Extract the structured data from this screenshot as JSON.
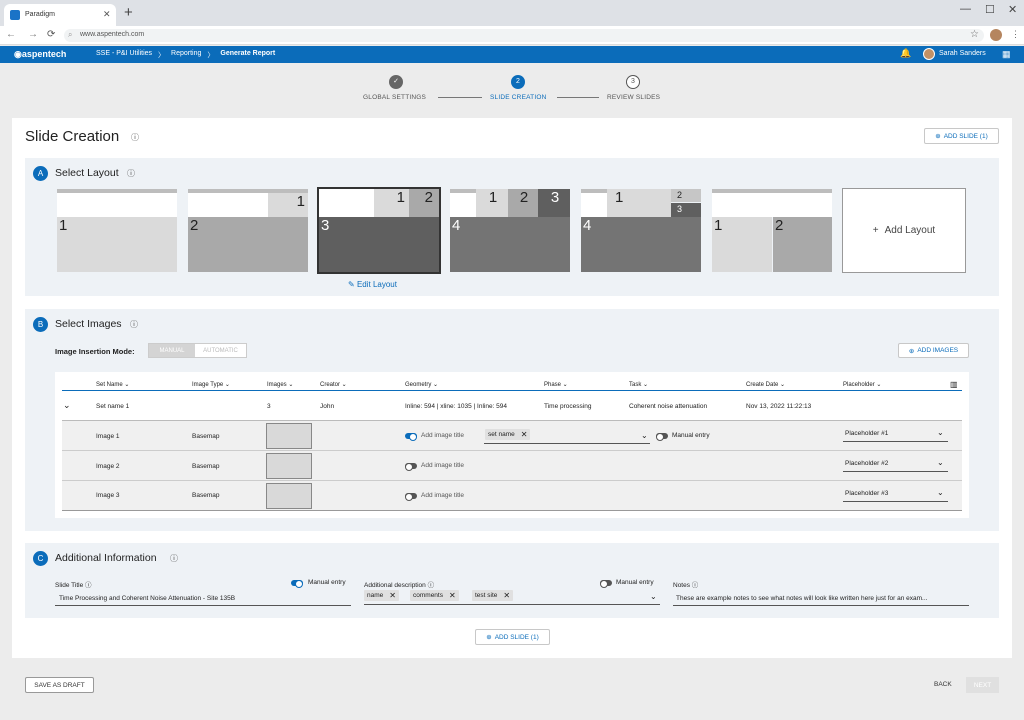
{
  "browser": {
    "tab_title": "Paradigm",
    "url": "www.aspentech.com"
  },
  "header": {
    "logo": "aspentech",
    "breadcrumbs": [
      "SSE - P&I Utilities",
      "Reporting",
      "Generate Report"
    ],
    "user": "Sarah Sanders"
  },
  "stepper": [
    {
      "num": "✓",
      "label": "GLOBAL SETTINGS"
    },
    {
      "num": "2",
      "label": "SLIDE CREATION"
    },
    {
      "num": "3",
      "label": "REVIEW SLIDES"
    }
  ],
  "page": {
    "title": "Slide Creation",
    "add_slide_top": "ADD SLIDE (1)",
    "add_slide_bottom": "ADD SLIDE (1)"
  },
  "layout_section": {
    "badge": "A",
    "title": "Select Layout",
    "edit_label": "Edit Layout",
    "add_layout": "Add Layout",
    "cards": [
      [
        "1"
      ],
      [
        "2",
        "1"
      ],
      [
        "3",
        "1",
        "2"
      ],
      [
        "4",
        "1",
        "2",
        "3"
      ],
      [
        "4",
        "1",
        "2",
        "3"
      ],
      [
        "1",
        "2"
      ]
    ]
  },
  "images_section": {
    "badge": "B",
    "title": "Select Images",
    "mode_label": "Image Insertion Mode:",
    "mode_options": [
      "MANUAL",
      "AUTOMATIC"
    ],
    "add_images": "ADD IMAGES",
    "columns": [
      "Set Name",
      "Image Type",
      "Images",
      "Creator",
      "Geometry",
      "Phase",
      "Task",
      "Create Date",
      "Placeholder"
    ],
    "set_row": {
      "name": "Set name 1",
      "images": "3",
      "creator": "John",
      "geometry": "Inline: 594 | xline: 1035 | Inline: 594",
      "phase": "Time processing",
      "task": "Coherent noise attenuation",
      "date": "Nov 13, 2022 11:22:13"
    },
    "image_rows": [
      {
        "name": "Image 1",
        "type": "Basemap",
        "title_label": "Add image title",
        "chip": "set name",
        "manual": "Manual entry",
        "placeholder": "Placeholder #1"
      },
      {
        "name": "Image 2",
        "type": "Basemap",
        "title_label": "Add image title",
        "placeholder": "Placeholder #2"
      },
      {
        "name": "Image 3",
        "type": "Basemap",
        "title_label": "Add image title",
        "placeholder": "Placeholder #3"
      }
    ]
  },
  "info_section": {
    "badge": "C",
    "title": "Additional Information",
    "slide_title_label": "Slide Title",
    "manual_entry": "Manual entry",
    "slide_title_value": "Time Processing and Coherent Noise Attenuation - Site 135B",
    "desc_label": "Additional description",
    "desc_manual": "Manual entry",
    "desc_chips": [
      "name",
      "comments",
      "test site"
    ],
    "notes_label": "Notes",
    "notes_value": "These are example notes to see what notes will look like written here just for an exam..."
  },
  "footer": {
    "save_draft": "SAVE AS DRAFT",
    "back": "BACK",
    "next": "NEXT"
  }
}
